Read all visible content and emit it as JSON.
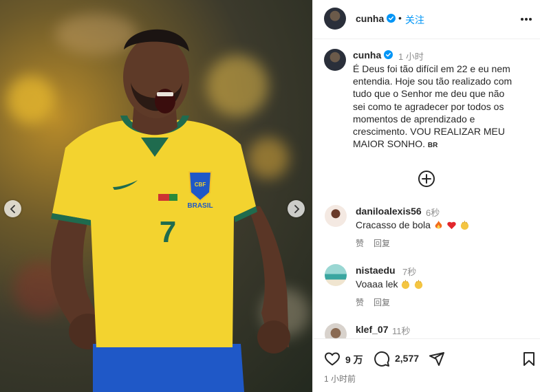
{
  "post": {
    "image_alt": "Player in yellow Brasil jersey number 7 celebrating",
    "jersey": {
      "crest_text": "CBF",
      "team_text": "BRASIL",
      "number": "7"
    }
  },
  "header": {
    "username": "cunha",
    "separator": "•",
    "follow_label": "关注"
  },
  "caption": {
    "username": "cunha",
    "time": "1 小时",
    "lines": [
      "É Deus foi tão difícil em 22 e eu nem",
      "entendia. Hoje sou tão realizado com",
      "tudo que o Senhor me deu que não",
      "sei como te agradecer por todos os",
      "momentos de aprendizado e",
      "crescimento. VOU REALIZAR MEU"
    ],
    "last_line": "MAIOR SONHO.",
    "flag_tag": "BR"
  },
  "comments": [
    {
      "user": "daniloalexis56",
      "time": "6秒",
      "text": "Cracasso de bola",
      "like": "赞",
      "reply": "回复"
    },
    {
      "user": "nistaedu",
      "time": "7秒",
      "text": "Voaaa lek",
      "like": "赞",
      "reply": "回复"
    },
    {
      "user": "klef_07",
      "time": "11秒",
      "text": "",
      "like": "",
      "reply": ""
    }
  ],
  "footer": {
    "likes": "9 万",
    "comments": "2,577",
    "time": "1 小时前"
  },
  "colors": {
    "accent": "#0095f6",
    "verified": "#0095f6",
    "muted": "#8e8e8e",
    "jersey_yellow": "#f3d32f",
    "jersey_green": "#1f6b4e",
    "shorts_blue": "#1f58c7"
  },
  "icons": [
    "chevron-left-icon",
    "chevron-right-icon",
    "verified-icon",
    "more-icon",
    "add-circle-icon",
    "heart-icon",
    "comment-icon",
    "share-icon",
    "bookmark-icon"
  ]
}
